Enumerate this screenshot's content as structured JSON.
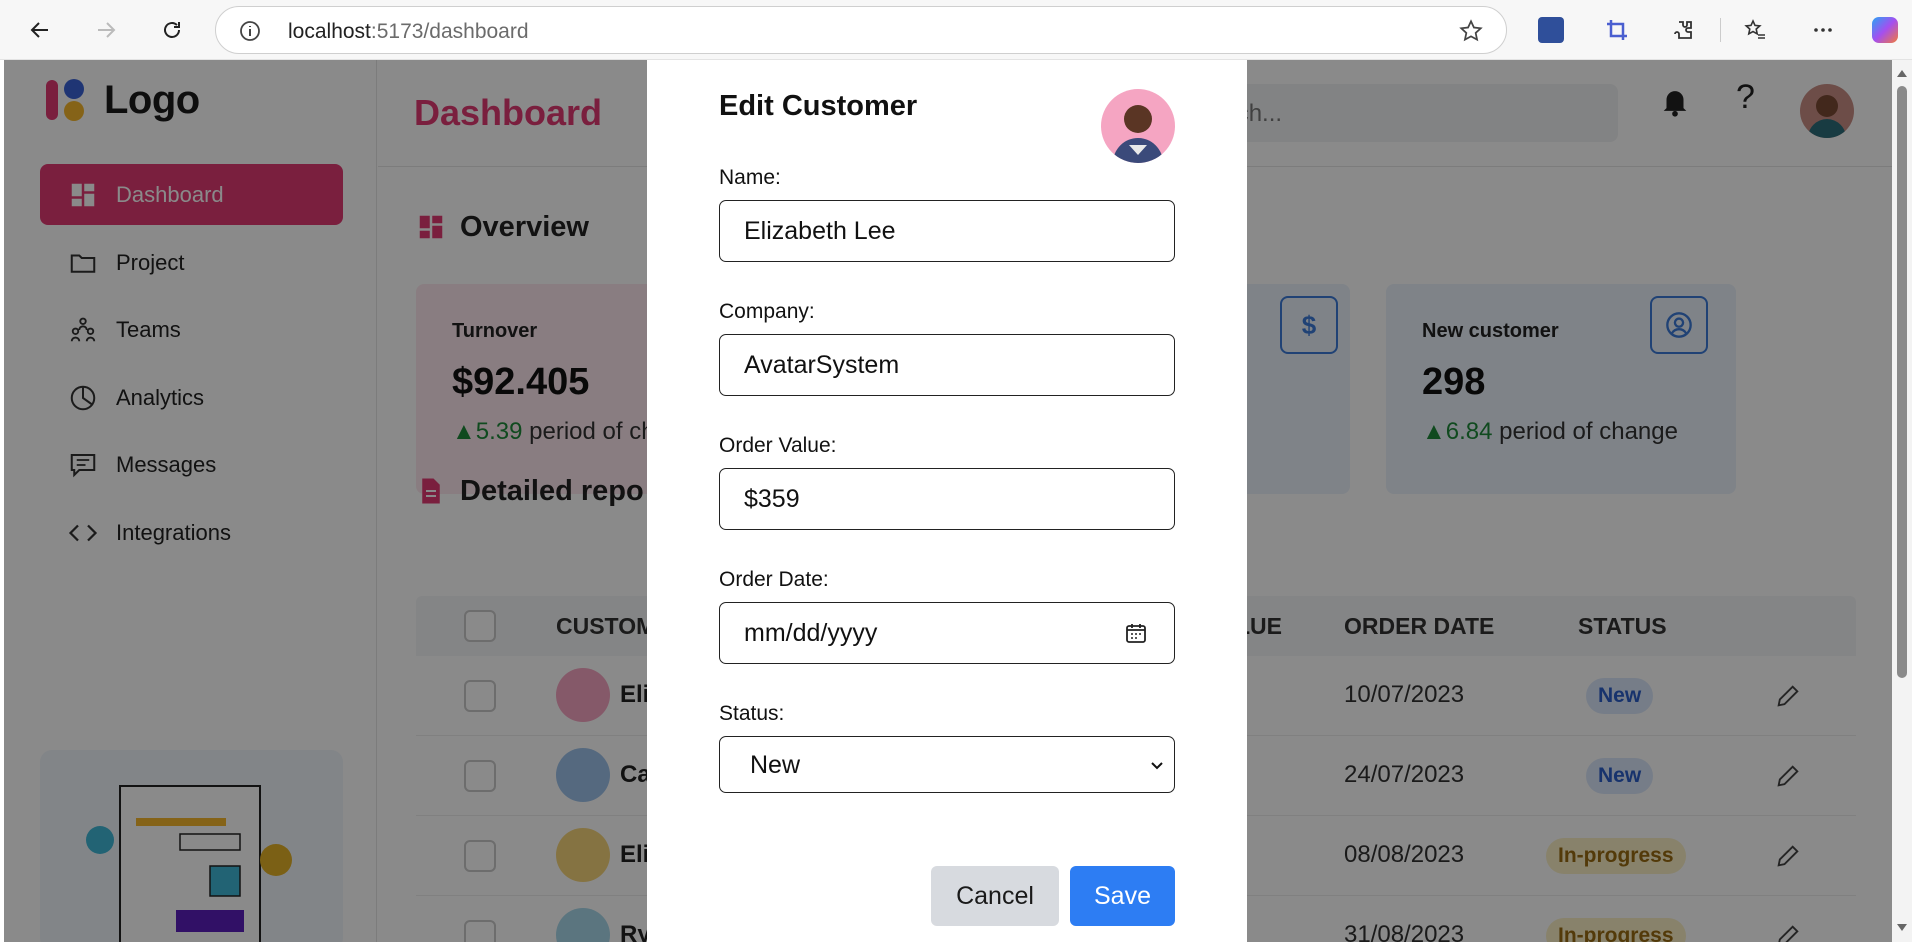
{
  "browser": {
    "url_host": "localhost",
    "url_path": ":5173/dashboard"
  },
  "sidebar": {
    "logo_text": "Logo",
    "items": [
      {
        "label": "Dashboard",
        "icon": "dashboard-icon",
        "active": true
      },
      {
        "label": "Project",
        "icon": "folder-icon"
      },
      {
        "label": "Teams",
        "icon": "teams-icon"
      },
      {
        "label": "Analytics",
        "icon": "pie-chart-icon"
      },
      {
        "label": "Messages",
        "icon": "message-icon"
      },
      {
        "label": "Integrations",
        "icon": "code-icon"
      }
    ]
  },
  "header": {
    "title": "Dashboard",
    "search_placeholder": "Search...",
    "help_glyph": "?"
  },
  "overview": {
    "title": "Overview",
    "cards": [
      {
        "label": "Turnover",
        "value": "$92.405",
        "change": "5.39",
        "change_text": "period of ch"
      },
      {
        "label": "",
        "value": "",
        "icon_glyph": "$"
      },
      {
        "label": "New customer",
        "value": "298",
        "change": "6.84",
        "change_text": "period of change"
      }
    ]
  },
  "report": {
    "title": "Detailed repo",
    "columns": [
      "CUSTOM",
      "LUE",
      "ORDER DATE",
      "STATUS"
    ],
    "rows": [
      {
        "name": "Eli",
        "date": "10/07/2023",
        "status": "New"
      },
      {
        "name": "Ca",
        "date": "24/07/2023",
        "status": "New"
      },
      {
        "name": "Eli",
        "date": "08/08/2023",
        "status": "In-progress"
      },
      {
        "name": "Ry",
        "date": "31/08/2023",
        "status": "In-progress"
      }
    ]
  },
  "modal": {
    "title": "Edit Customer",
    "name_label": "Name:",
    "name_value": "Elizabeth Lee",
    "company_label": "Company:",
    "company_value": "AvatarSystem",
    "order_value_label": "Order Value:",
    "order_value_value": "$359",
    "order_date_label": "Order Date:",
    "order_date_placeholder": "mm/dd/yyyy",
    "status_label": "Status:",
    "status_value": "New",
    "cancel_label": "Cancel",
    "save_label": "Save"
  },
  "colors": {
    "brand": "#e13a73",
    "primary_button": "#2d7df3",
    "overlay": "rgba(0,0,0,0.46)"
  }
}
